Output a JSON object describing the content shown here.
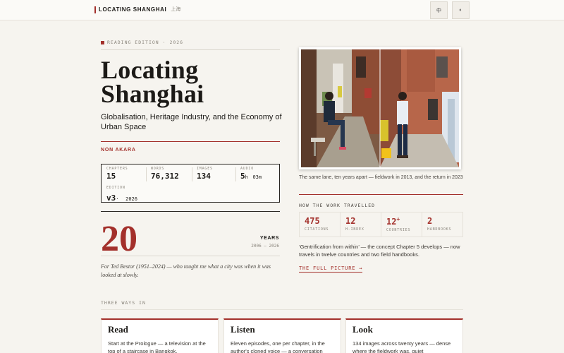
{
  "header": {
    "brand_en": "LOCATING SHANGHAI",
    "brand_zh": "上海",
    "lang_button": "中",
    "theme_button": "◐"
  },
  "hero": {
    "eyebrow": "READING EDITION · 2026",
    "title_line1": "Locating",
    "title_line2": "Shanghai",
    "subtitle": "Globalisation, Heritage Industry, and the Economy of Urban Space",
    "author": "NON AKARA"
  },
  "stats": {
    "chapters": {
      "label": "CHAPTERS",
      "value": "15"
    },
    "words": {
      "label": "WORDS",
      "value": "76,312"
    },
    "images": {
      "label": "IMAGES",
      "value": "134"
    },
    "audio": {
      "label": "AUDIO",
      "hours": "5",
      "h_unit": "h",
      "minutes": "03",
      "m_unit": "m"
    },
    "edition": {
      "label": "EDITION",
      "value": "v3",
      "sep": "·",
      "year": "2026"
    }
  },
  "years": {
    "number": "20",
    "label": "YEARS",
    "range": "2006 — 2026"
  },
  "dedication": "For Ted Bestor (1951–2024) — who taught me what a city was when it was looked at slowly.",
  "photo": {
    "caption": "The same lane, ten years apart — fieldwork in 2013, and the return in 2023"
  },
  "travelled": {
    "label": "HOW THE WORK TRAVELLED",
    "metrics": [
      {
        "value": "475",
        "label": "CITATIONS"
      },
      {
        "value": "12",
        "label": "H-INDEX"
      },
      {
        "value": "12",
        "suffix": "+",
        "label": "COUNTRIES"
      },
      {
        "value": "2",
        "label": "HANDBOOKS"
      }
    ],
    "quote": "‘Gentrification from within’ — the concept Chapter 5 develops — now travels in twelve countries and two field handbooks.",
    "link": "THE FULL PICTURE →"
  },
  "ways": {
    "label": "THREE WAYS IN",
    "cards": [
      {
        "title": "Read",
        "text": "Start at the Prologue — a television at the top of a staircase in Bangkok."
      },
      {
        "title": "Listen",
        "text": "Eleven episodes, one per chapter, in the author's cloned voice — a conversation"
      },
      {
        "title": "Look",
        "text": "134 images across twenty years — dense where the fieldwork was, quiet"
      }
    ]
  },
  "colors": {
    "accent": "#a3302b",
    "background": "#f6f4ef",
    "ink": "#1c1a17"
  }
}
